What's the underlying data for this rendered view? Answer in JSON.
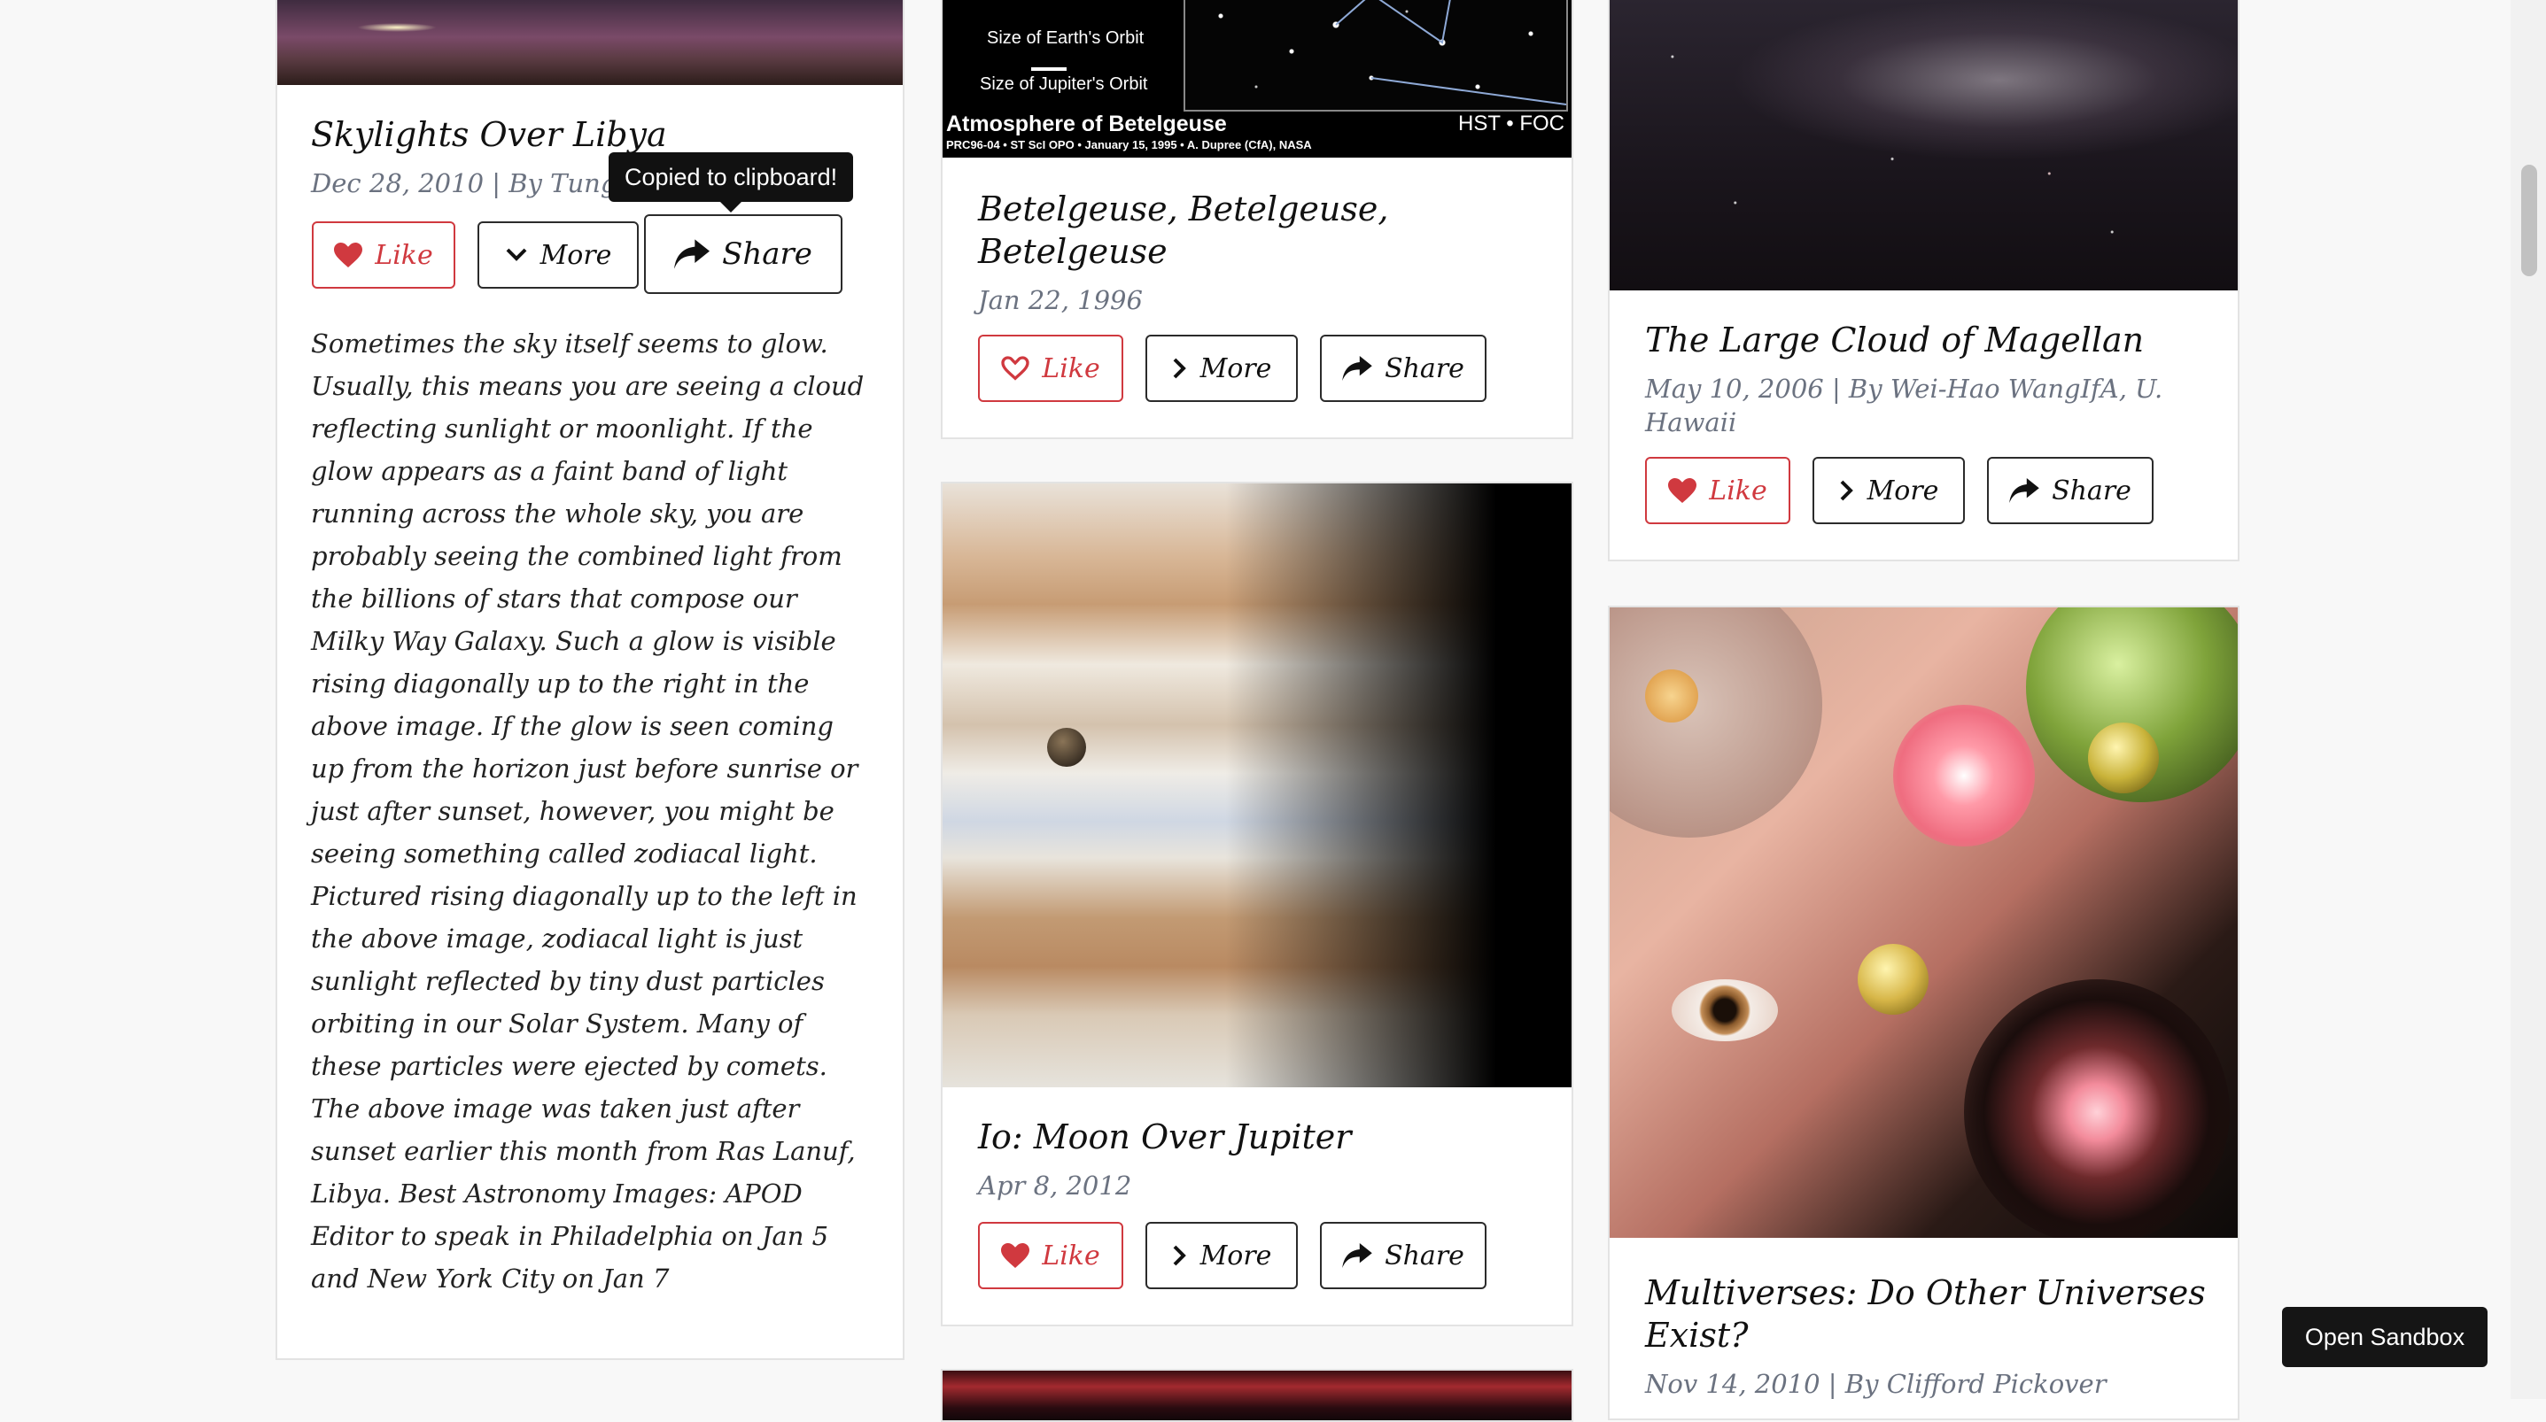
{
  "cards": [
    {
      "title": "Skylights Over Libya",
      "meta": "Dec 28, 2010 | By Tung",
      "like_label": "Like",
      "more_label": "More",
      "share_label": "Share",
      "tooltip": "Copied to clipboard!",
      "description": "Sometimes the sky itself seems to glow. Usually, this means you are seeing a cloud reflecting sunlight or moonlight. If the glow appears as a faint band of light running across the whole sky, you are probably seeing the combined light from the billions of stars that compose our Milky Way Galaxy. Such a glow is visible rising diagonally up to the right in the above image. If the glow is seen coming up from the horizon just before sunrise or just after sunset, however, you might be seeing something called zodiacal light. Pictured rising diagonally up to the left in the above image, zodiacal light is just sunlight reflected by tiny dust particles orbiting in our Solar System. Many of these particles were ejected by comets. The above image was taken just after sunset earlier this month from Ras Lanuf, Libya. Best Astronomy Images: APOD Editor to speak in Philadelphia on Jan 5 and New York City on Jan 7"
    },
    {
      "title": "Betelgeuse, Betelgeuse, Betelgeuse",
      "meta": "Jan 22, 1996",
      "like_label": "Like",
      "more_label": "More",
      "share_label": "Share",
      "image_text": {
        "earth_orbit": "Size of Earth's Orbit",
        "jupiter_orbit": "Size of Jupiter's Orbit",
        "caption": "Atmosphere of Betelgeuse",
        "instrument": "HST • FOC",
        "credit": "PRC96-04 • ST ScI OPO • January 15, 1995 • A. Dupree (CfA), NASA"
      }
    },
    {
      "title": "Io: Moon Over Jupiter",
      "meta": "Apr 8, 2012",
      "like_label": "Like",
      "more_label": "More",
      "share_label": "Share"
    },
    {
      "title": "The Large Cloud of Magellan",
      "meta": "May 10, 2006 | By Wei-Hao WangIfA, U. Hawaii",
      "like_label": "Like",
      "more_label": "More",
      "share_label": "Share"
    },
    {
      "title": "Multiverses: Do Other Universes Exist?",
      "meta": "Nov 14, 2010 | By Clifford Pickover"
    }
  ],
  "sandbox_label": "Open Sandbox",
  "icons": [
    "heart-icon",
    "chevron-down-icon",
    "chevron-right-icon",
    "share-icon"
  ],
  "colors": {
    "like": "#d0393f",
    "text": "#111111",
    "muted": "#6b7280",
    "background": "#f8f8f8"
  }
}
